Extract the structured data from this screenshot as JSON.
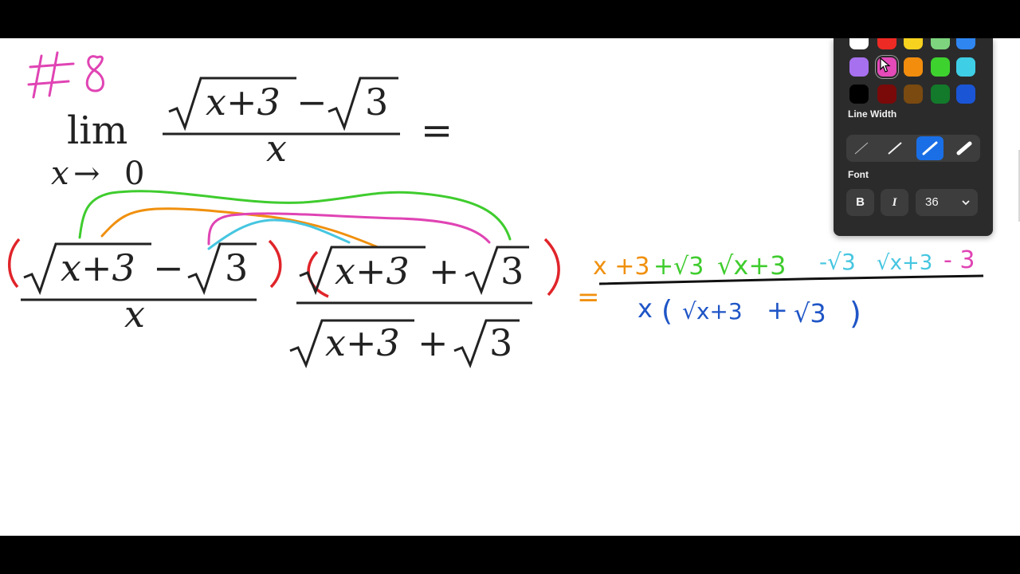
{
  "board": {
    "problem_label": "#8",
    "limit_word": "lim",
    "limit_sub_var": "x",
    "limit_sub_arrow": "→",
    "limit_sub_to": "0",
    "limit_numer_a": "x+3",
    "limit_numer_op": "−",
    "limit_numer_b": "3",
    "limit_denom": "x",
    "equals": "=",
    "frac1_numer_a": "x+3",
    "frac1_numer_op": "−",
    "frac1_numer_b": "3",
    "frac1_denom": "x",
    "frac2_numer_a": "x+3",
    "frac2_numer_op": "+",
    "frac2_numer_b": "3",
    "frac2_denom_a": "x+3",
    "frac2_denom_op": "+",
    "frac2_denom_b": "3",
    "hw_equals": "=",
    "hw_numer_1": "x +3",
    "hw_numer_2": "+√3",
    "hw_numer_3": "√x+3",
    "hw_numer_4": "-√3",
    "hw_numer_5": "√x+3",
    "hw_numer_6": "- 3",
    "hw_denom_x": "x",
    "hw_denom_open": "(",
    "hw_denom_root1": "√x+3",
    "hw_denom_plus": "+",
    "hw_denom_root2": "√3",
    "hw_denom_close": ")"
  },
  "panel": {
    "colors_selected": "pink",
    "colors": [
      {
        "name": "white",
        "hex": "#ffffff"
      },
      {
        "name": "red",
        "hex": "#ee2a24"
      },
      {
        "name": "yellow",
        "hex": "#f7d21f"
      },
      {
        "name": "light-green",
        "hex": "#7ed47e"
      },
      {
        "name": "light-blue",
        "hex": "#2f86f0"
      },
      {
        "name": "purple",
        "hex": "#a770ef"
      },
      {
        "name": "pink",
        "hex": "#e54ab9"
      },
      {
        "name": "orange",
        "hex": "#f38d0d"
      },
      {
        "name": "green",
        "hex": "#3ed22f"
      },
      {
        "name": "cyan",
        "hex": "#3ecfe6"
      },
      {
        "name": "black",
        "hex": "#000000"
      },
      {
        "name": "dark-red",
        "hex": "#7a0a0a"
      },
      {
        "name": "brown",
        "hex": "#7a4a10"
      },
      {
        "name": "dark-green",
        "hex": "#127a2a"
      },
      {
        "name": "blue",
        "hex": "#1a55d6"
      }
    ],
    "line_width_label": "Line Width",
    "line_width_selected_index": 2,
    "font_label": "Font",
    "bold_label": "B",
    "italic_label": "I",
    "font_size_value": "36",
    "font_size_chevron": "chevron-down-icon"
  },
  "ink_colors": {
    "pink": "#e044b4",
    "red": "#e0242a",
    "green": "#3fcc2e",
    "orange": "#f0900e",
    "cyan": "#46c6e0",
    "blue": "#1f55c6"
  }
}
